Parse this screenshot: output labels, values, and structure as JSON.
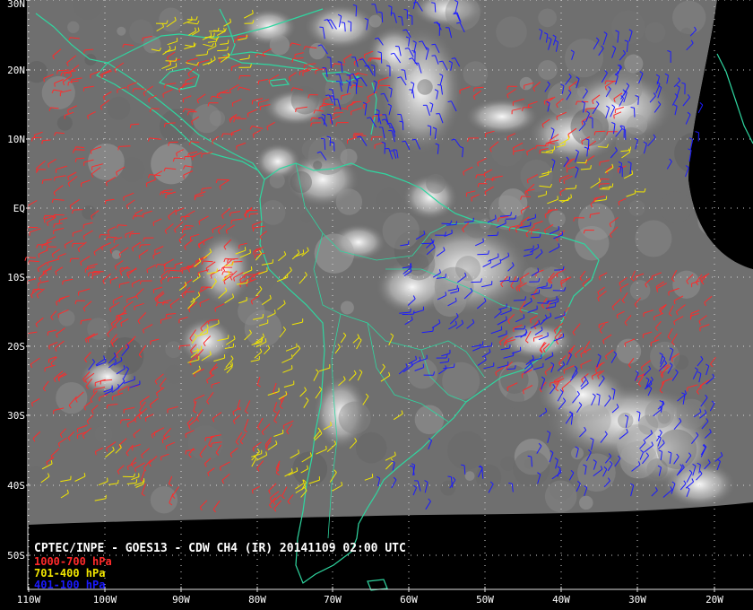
{
  "title": "CPTEC/INPE - GOES13 - CDW CH4 (IR) 20141109 02:00 UTC",
  "legend": [
    {
      "label": "1000-700 hPa",
      "color": "#ff2a2a"
    },
    {
      "label": "701-400 hPa",
      "color": "#f2e600"
    },
    {
      "label": "401-100 hPa",
      "color": "#1a1aff"
    }
  ],
  "lat_labels": [
    "30N",
    "20N",
    "10N",
    "EQ",
    "10S",
    "20S",
    "30S",
    "40S",
    "50S"
  ],
  "lon_labels": [
    "110W",
    "100W",
    "90W",
    "80W",
    "70W",
    "60W",
    "50W",
    "40W",
    "30W",
    "20W"
  ],
  "colors": {
    "coast": "#2fd6a0",
    "grid": "#d8d8d8",
    "frame": "#e0e0e0"
  }
}
